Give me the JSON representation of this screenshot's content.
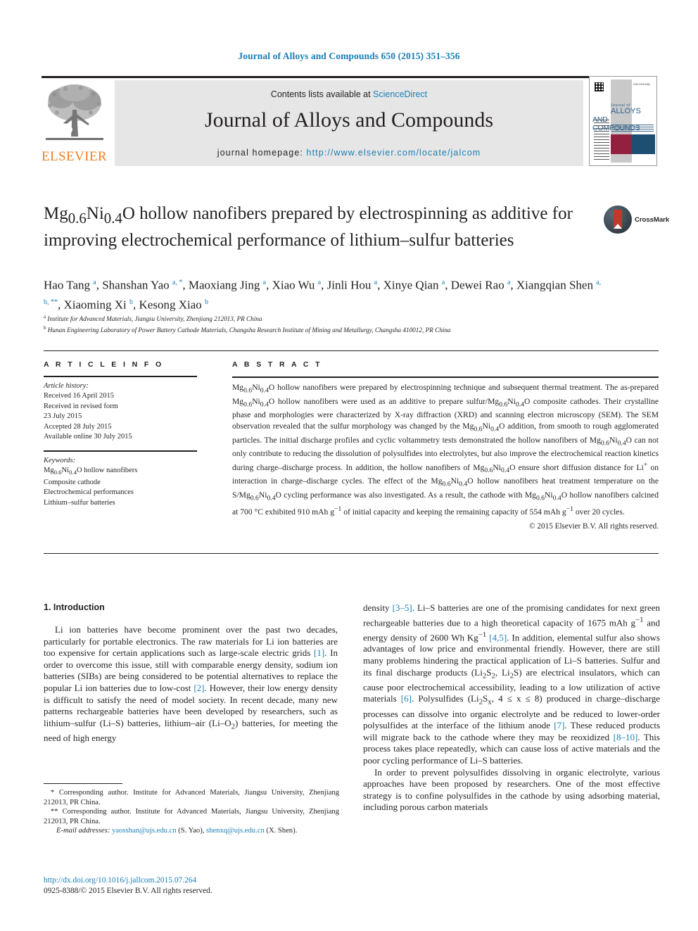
{
  "running_head": "Journal of Alloys and Compounds 650 (2015) 351–356",
  "header": {
    "contents_prefix": "Contents lists available at ",
    "sciencedirect": "ScienceDirect",
    "journal_title": "Journal of Alloys and Compounds",
    "homepage_label": "journal homepage: ",
    "homepage_url": "http://www.elsevier.com/locate/jalcom",
    "publisher": "ELSEVIER",
    "cover": {
      "journal_of": "Journal of",
      "alloys": "ALLOYS",
      "and_compounds": "AND COMPOUNDS",
      "issn": "ISSN 0925-8388"
    }
  },
  "crossmark": {
    "label": "CrossMark"
  },
  "article": {
    "title_line1": "Mg",
    "title": "Mg0.6Ni0.4O hollow nanofibers prepared by electrospinning as additive for improving electrochemical performance of lithium–sulfur batteries",
    "authors": [
      {
        "name": "Hao Tang",
        "marks": "a"
      },
      {
        "name": "Shanshan Yao",
        "marks": "a, *"
      },
      {
        "name": "Maoxiang Jing",
        "marks": "a"
      },
      {
        "name": "Xiao Wu",
        "marks": "a"
      },
      {
        "name": "Jinli Hou",
        "marks": "a"
      },
      {
        "name": "Xinye Qian",
        "marks": "a"
      },
      {
        "name": "Dewei Rao",
        "marks": "a"
      },
      {
        "name": "Xiangqian Shen",
        "marks": "a, b, **"
      },
      {
        "name": "Xiaoming Xi",
        "marks": "b"
      },
      {
        "name": "Kesong Xiao",
        "marks": "b"
      }
    ],
    "affiliations": [
      {
        "mark": "a",
        "text": "Institute for Advanced Materials, Jiangsu University, Zhenjiang 212013, PR China"
      },
      {
        "mark": "b",
        "text": "Hunan Engineering Laboratory of Power Battery Cathode Materials, Changsha Research Institute of Mining and Metallurgy, Changsha 410012, PR China"
      }
    ]
  },
  "article_info": {
    "section_label": "A R T I C L E   I N F O",
    "history_label": "Article history:",
    "history": [
      "Received 16 April 2015",
      "Received in revised form",
      "23 July 2015",
      "Accepted 28 July 2015",
      "Available online 30 July 2015"
    ],
    "keywords_label": "Keywords:",
    "keywords": [
      "Mg0.6Ni0.4O hollow nanofibers",
      "Composite cathode",
      "Electrochemical performances",
      "Lithium–sulfur batteries"
    ]
  },
  "abstract": {
    "section_label": "A B S T R A C T",
    "text": "Mg0.6Ni0.4O hollow nanofibers were prepared by electrospinning technique and subsequent thermal treatment. The as-prepared Mg0.6Ni0.4O hollow nanofibers were used as an additive to prepare sulfur/Mg0.6Ni0.4O composite cathodes. Their crystalline phase and morphologies were characterized by X-ray diffraction (XRD) and scanning electron microscopy (SEM). The SEM observation revealed that the sulfur morphology was changed by the Mg0.6Ni0.4O addition, from smooth to rough agglomerated particles. The initial discharge profiles and cyclic voltammetry tests demonstrated the hollow nanofibers of Mg0.6Ni0.4O can not only contribute to reducing the dissolution of polysulfides into electrolytes, but also improve the electrochemical reaction kinetics during charge–discharge process. In addition, the hollow nanofibers of Mg0.6Ni0.4O ensure short diffusion distance for Li+ on interaction in charge–discharge cycles. The effect of the Mg0.6Ni0.4O hollow nanofibers heat treatment temperature on the S/Mg0.6Ni0.4O cycling performance was also investigated. As a result, the cathode with Mg0.6Ni0.4O hollow nanofibers calcined at 700 °C exhibited 910 mAh g−1 of initial capacity and keeping the remaining capacity of 554 mAh g−1 over 20 cycles.",
    "copyright": "© 2015 Elsevier B.V. All rights reserved."
  },
  "introduction": {
    "heading": "1. Introduction",
    "para1": "Li ion batteries have become prominent over the past two decades, particularly for portable electronics. The raw materials for Li ion batteries are too expensive for certain applications such as large-scale electric grids [1]. In order to overcome this issue, still with comparable energy density, sodium ion batteries (SIBs) are being considered to be potential alternatives to replace the popular Li ion batteries due to low-cost [2]. However, their low energy density is difficult to satisfy the need of model society. In recent decade, many new patterns rechargeable batteries have been developed by researchers, such as lithium–sulfur (Li–S) batteries, lithium–air (Li–O2) batteries, for meeting the need of high energy density [3–5]. Li–S batteries are one of the promising candidates for next green rechargeable batteries due to a high theoretical capacity of 1675 mAh g−1 and energy density of 2600 Wh Kg−1 [4,5]. In addition, elemental sulfur also shows advantages of low price and environmental friendly. However, there are still many problems hindering the practical application of Li–S batteries. Sulfur and its final discharge products (Li2S2, Li2S) are electrical insulators, which can cause poor electrochemical accessibility, leading to a low utilization of active materials [6]. Polysulfides (Li2Sx, 4 ≤ x ≤ 8) produced in charge–discharge processes can dissolve into organic electrolyte and be reduced to lower-order polysulfides at the interface of the lithium anode [7]. These reduced products will migrate back to the cathode where they may be reoxidized [8–10]. This process takes place repeatedly, which can cause loss of active materials and the poor cycling performance of Li–S batteries.",
    "para2": "In order to prevent polysulfides dissolving in organic electrolyte, various approaches have been proposed by researchers. One of the most effective strategy is to confine polysulfides in the cathode by using adsorbing material, including porous carbon materials"
  },
  "footnotes": {
    "corr1": "* Corresponding author. Institute for Advanced Materials, Jiangsu University, Zhenjiang 212013, PR China.",
    "corr2": "** Corresponding author. Institute for Advanced Materials, Jiangsu University, Zhenjiang 212013, PR China.",
    "email_label": "E-mail addresses:",
    "email1": "yaosshan@ujs.edu.cn",
    "email1_owner": "(S. Yao),",
    "email2": "shenxq@ujs.edu.cn",
    "email2_owner": "(X. Shen).",
    "doi": "http://dx.doi.org/10.1016/j.jallcom.2015.07.264",
    "issn_line": "0925-8388/© 2015 Elsevier B.V. All rights reserved."
  },
  "colors": {
    "link": "#1a7fb5",
    "elsevier_orange": "#ee7f22",
    "ink": "#231f20",
    "band": "#e6e6e6"
  }
}
